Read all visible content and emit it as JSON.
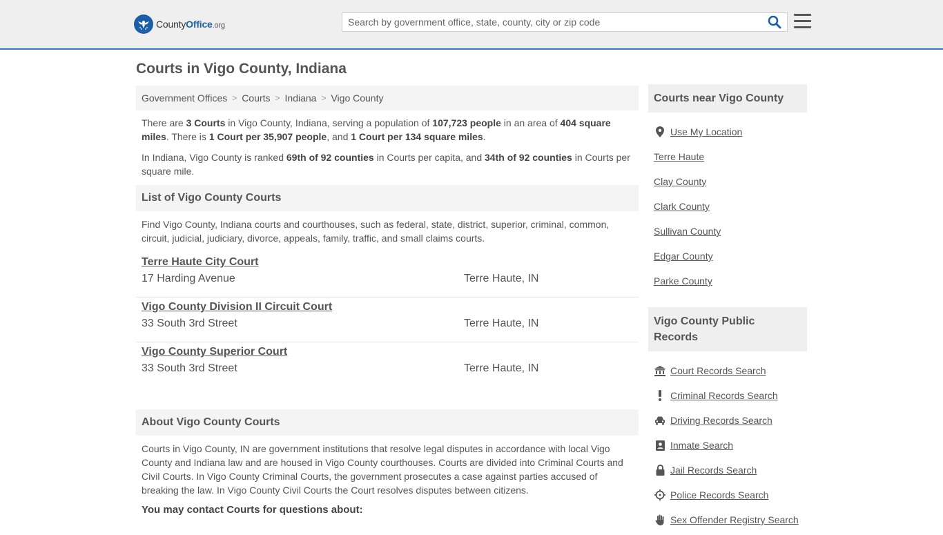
{
  "header": {
    "logo_text_a": "County",
    "logo_text_b": "Office",
    "logo_tld": ".org",
    "search_placeholder": "Search by government office, state, county, city or zip code"
  },
  "page": {
    "title": "Courts in Vigo County, Indiana"
  },
  "breadcrumb": [
    "Government Offices",
    "Courts",
    "Indiana",
    "Vigo County"
  ],
  "intro": {
    "p1_a": "There are ",
    "p1_b": "3 Courts",
    "p1_c": " in Vigo County, Indiana, serving a population of ",
    "p1_d": "107,723 people",
    "p1_e": " in an area of ",
    "p1_f": "404 square miles",
    "p1_g": ". There is ",
    "p1_h": "1 Court per 35,907 people",
    "p1_i": ", and ",
    "p1_j": "1 Court per 134 square miles",
    "p1_k": ".",
    "p2_a": "In Indiana, Vigo County is ranked ",
    "p2_b": "69th of 92 counties",
    "p2_c": " in Courts per capita, and ",
    "p2_d": "34th of 92 counties",
    "p2_e": " in Courts per square mile."
  },
  "list": {
    "heading": "List of Vigo County Courts",
    "description": "Find Vigo County, Indiana courts and courthouses, such as federal, state, district, superior, criminal, common, circuit, judicial, judiciary, divorce, appeals, family, traffic, and small claims courts.",
    "courts": [
      {
        "name": "Terre Haute City Court",
        "address": "17 Harding Avenue",
        "city": "Terre Haute, IN"
      },
      {
        "name": "Vigo County Division II Circuit Court",
        "address": "33 South 3rd Street",
        "city": "Terre Haute, IN"
      },
      {
        "name": "Vigo County Superior Court",
        "address": "33 South 3rd Street",
        "city": "Terre Haute, IN"
      }
    ]
  },
  "about": {
    "heading": "About Vigo County Courts",
    "text": "Courts in Vigo County, IN are government institutions that resolve legal disputes in accordance with local Vigo County and Indiana law and are housed in Vigo County courthouses. Courts are divided into Criminal Courts and Civil Courts. In Vigo County Criminal Courts, the government prosecutes a case against parties accused of breaking the law. In Vigo County Civil Courts the Court resolves disputes between citizens.",
    "contact_heading": "You may contact Courts for questions about:"
  },
  "sidebar": {
    "near_heading": "Courts near Vigo County",
    "near_items": [
      {
        "label": "Use My Location",
        "icon": "map-pin-icon"
      },
      {
        "label": "Terre Haute"
      },
      {
        "label": "Clay County"
      },
      {
        "label": "Clark County"
      },
      {
        "label": "Sullivan County"
      },
      {
        "label": "Edgar County"
      },
      {
        "label": "Parke County"
      }
    ],
    "records_heading": "Vigo County Public Records",
    "records_items": [
      {
        "label": "Court Records Search",
        "icon": "courthouse-icon"
      },
      {
        "label": "Criminal Records Search",
        "icon": "exclamation-icon"
      },
      {
        "label": "Driving Records Search",
        "icon": "car-icon"
      },
      {
        "label": "Inmate Search",
        "icon": "id-card-icon"
      },
      {
        "label": "Jail Records Search",
        "icon": "lock-icon"
      },
      {
        "label": "Police Records Search",
        "icon": "crosshair-icon"
      },
      {
        "label": "Sex Offender Registry Search",
        "icon": "hand-icon"
      }
    ]
  },
  "colors": {
    "brand_blue": "#1d5fa6",
    "header_border": "#3f76b6",
    "panel_bg": "#f4f4f4",
    "text": "#555555"
  }
}
